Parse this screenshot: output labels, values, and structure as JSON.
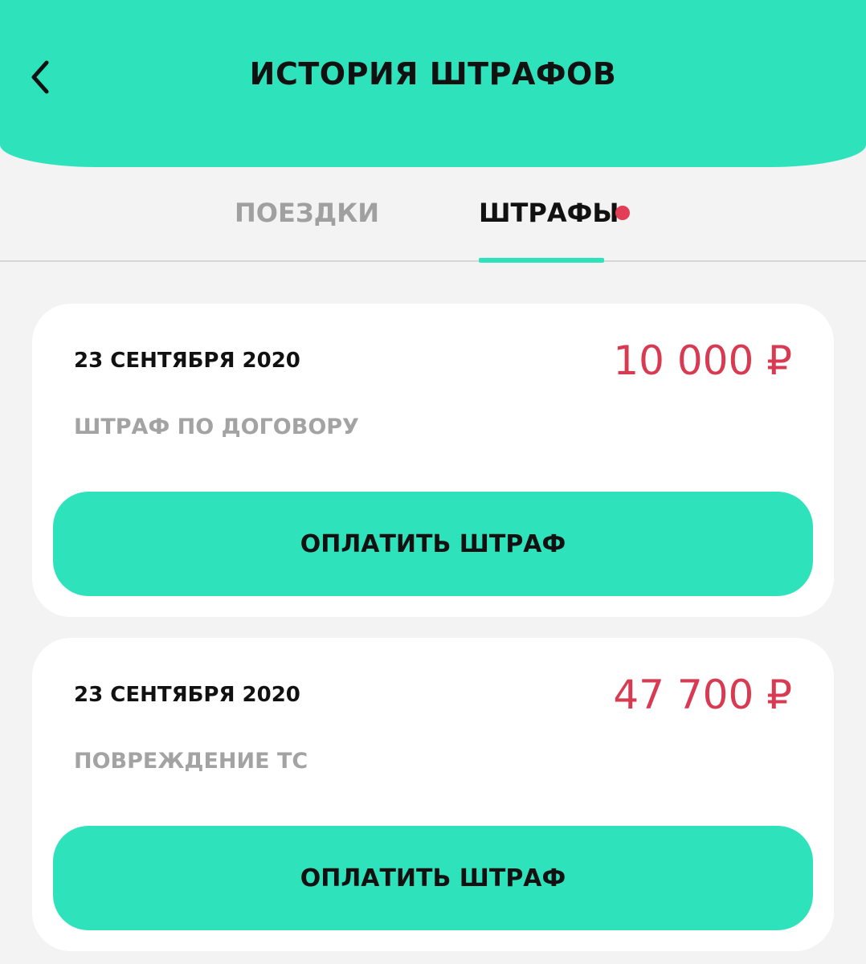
{
  "header": {
    "title": "ИСТОРИЯ ШТРАФОВ",
    "back_icon": "chevron-left-icon",
    "color": "#2ee2bb"
  },
  "tabs": [
    {
      "label": "ПОЕЗДКИ",
      "active": false
    },
    {
      "label": "ШТРАФЫ",
      "active": true,
      "has_badge": true
    }
  ],
  "colors": {
    "accent": "#2ee2bb",
    "amount": "#d83a52",
    "badge": "#e23e56"
  },
  "fines": [
    {
      "date": "23 СЕНТЯБРЯ 2020",
      "amount": "10 000 ₽",
      "type": "ШТРАФ ПО ДОГОВОРУ",
      "pay_label": "ОПЛАТИТЬ ШТРАФ"
    },
    {
      "date": "23 СЕНТЯБРЯ 2020",
      "amount": "47 700 ₽",
      "type": "ПОВРЕЖДЕНИЕ ТС",
      "pay_label": "ОПЛАТИТЬ ШТРАФ"
    }
  ]
}
